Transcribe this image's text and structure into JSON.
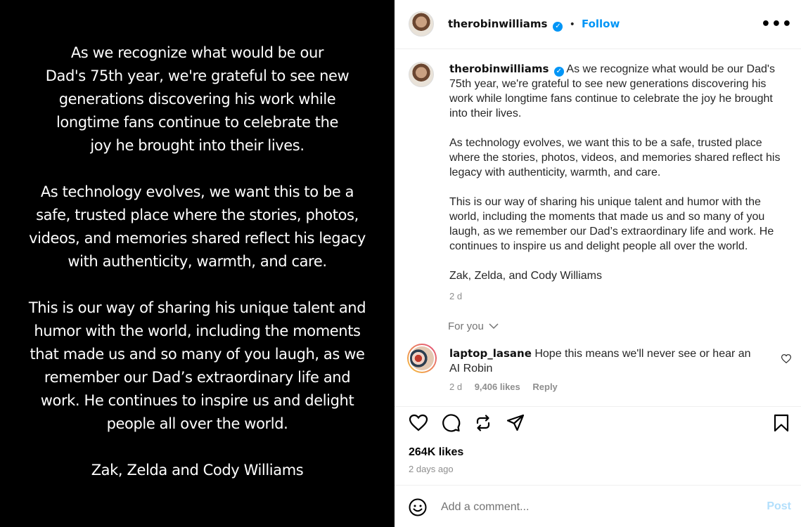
{
  "image_post": {
    "lines": [
      "As we recognize what would be our",
      "Dad's 75th year, we're grateful to see new",
      "generations discovering his work while",
      "longtime fans continue to celebrate the",
      "joy he brought into their lives.",
      "As technology evolves, we want this to be a",
      "safe, trusted place where the stories, photos,",
      "videos, and memories shared reflect his legacy",
      "with authenticity, warmth, and care.",
      "This is our way of sharing his unique talent and",
      "humor with the world, including the moments",
      "that made us and so many of you laugh, as we",
      "remember our Dad’s extraordinary life and",
      "work. He continues to inspire us and delight",
      "people all over the world.",
      "Zak, Zelda and Cody Williams"
    ]
  },
  "header": {
    "username": "therobinwilliams",
    "separator": "•",
    "follow_label": "Follow",
    "more_label": "•••",
    "verified_icon": "verified-badge-icon"
  },
  "caption": {
    "username": "therobinwilliams",
    "paragraphs": [
      "As we recognize what would be our Dad's 75th year, we're grateful to see new generations discovering his work while longtime fans continue to celebrate the joy he brought into their lives.",
      "As technology evolves, we want this to be a safe, trusted place where the stories, photos, videos, and memories shared reflect his legacy with authenticity, warmth, and care.",
      "This is our way of sharing his unique talent and humor with the world, including the moments that made us and so many of you laugh, as we remember our Dad’s extraordinary life and work. He continues to inspire us and delight people all over the world.",
      "Zak, Zelda, and Cody Williams"
    ],
    "time": "2 d"
  },
  "comments_filter": {
    "label": "For you",
    "icon": "chevron-down-icon"
  },
  "comment": {
    "username": "laptop_lasane",
    "text": "Hope this means we'll never see or hear an AI Robin",
    "time": "2 d",
    "likes": "9,406 likes",
    "reply_label": "Reply"
  },
  "actions": {
    "icons": [
      "heart-icon",
      "comment-icon",
      "repost-icon",
      "share-icon",
      "bookmark-icon"
    ],
    "likes_count": "264K likes",
    "date": "2 days ago"
  },
  "add_comment": {
    "placeholder": "Add a comment...",
    "post_label": "Post",
    "emoji_icon": "emoji-icon"
  },
  "colors": {
    "accent": "#0095f6",
    "post_disabled": "#b2dffc",
    "muted": "#8e8e8e"
  }
}
